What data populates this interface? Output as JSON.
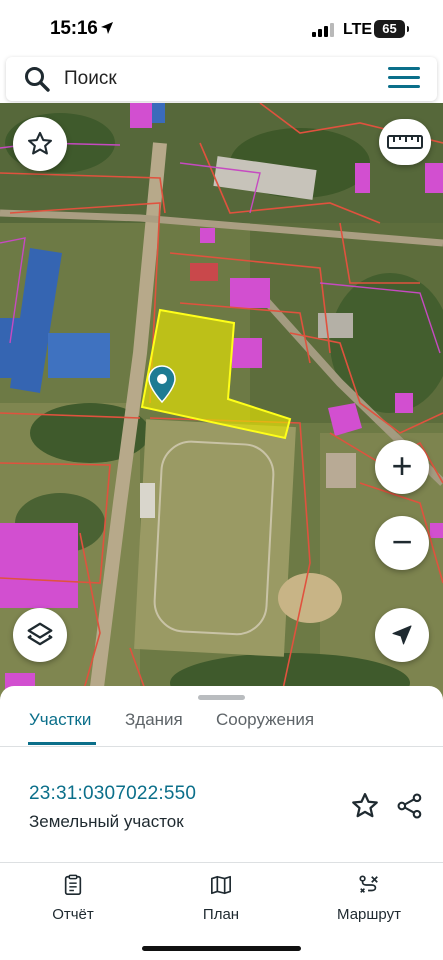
{
  "status_bar": {
    "time": "15:16",
    "network": "LTE",
    "battery": "65"
  },
  "search": {
    "placeholder": "Поиск",
    "icon": "search-icon",
    "menu_icon": "hamburger-menu-icon"
  },
  "map": {
    "marker_icon": "location-pin-icon",
    "parcel_highlight_color": "#e8e600",
    "boundary_color": "#e0523e",
    "building_color": "#d24fd0",
    "controls": {
      "favorite": "star-icon",
      "ruler": "ruler-icon",
      "zoom_in": "+",
      "zoom_out": "−",
      "layers": "layers-icon",
      "locate": "navigation-arrow-icon"
    }
  },
  "sheet": {
    "tabs": [
      {
        "label": "Участки",
        "active": true
      },
      {
        "label": "Здания",
        "active": false
      },
      {
        "label": "Сооружения",
        "active": false
      }
    ],
    "parcel": {
      "number": "23:31:0307022:550",
      "type": "Земельный участок"
    }
  },
  "bottom_nav": [
    {
      "label": "Отчёт",
      "icon": "report-icon"
    },
    {
      "label": "План",
      "icon": "map-icon"
    },
    {
      "label": "Маршрут",
      "icon": "route-icon"
    }
  ],
  "colors": {
    "accent": "#0b6f8a"
  }
}
